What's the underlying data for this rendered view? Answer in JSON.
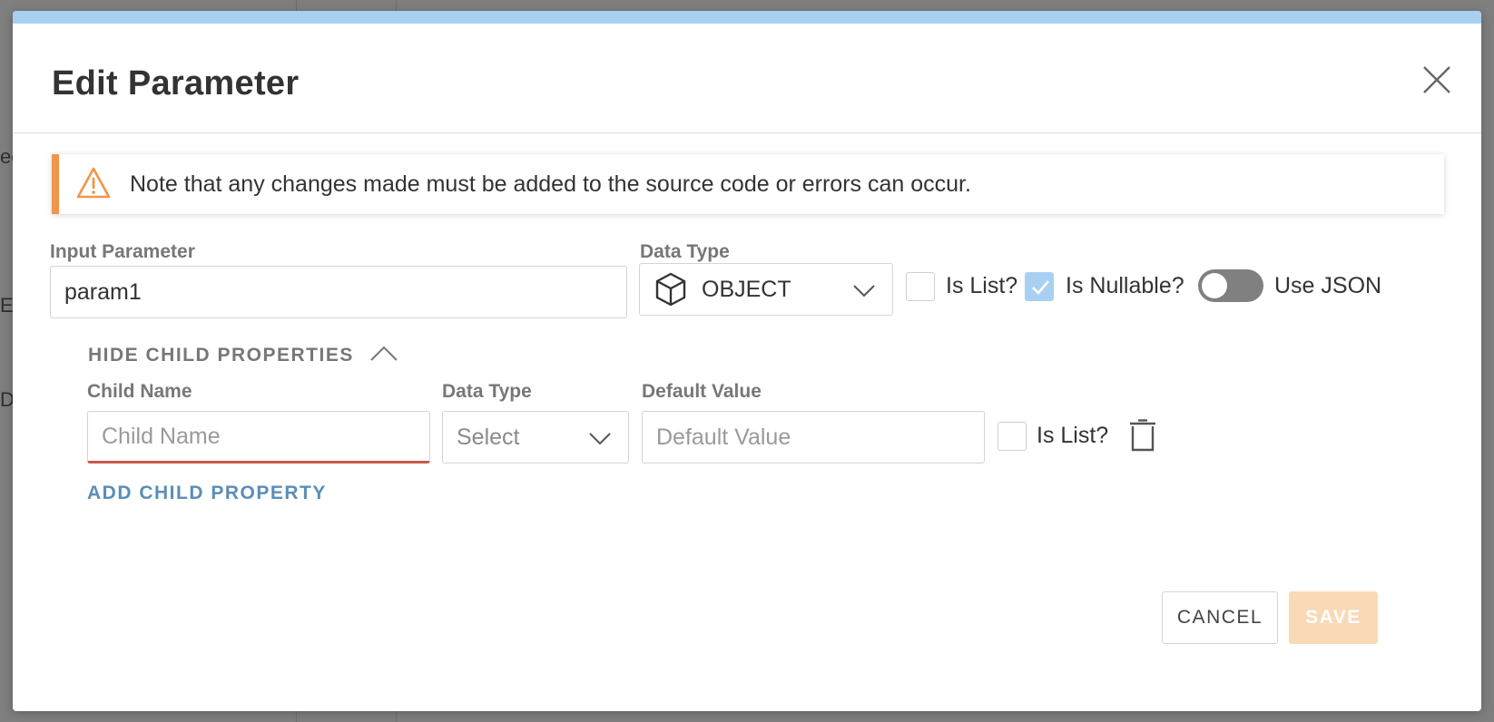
{
  "background": {
    "fragments": [
      "ec",
      "EX",
      "D"
    ]
  },
  "dialog": {
    "title": "Edit Parameter",
    "alert": {
      "icon": "warning-triangle-icon",
      "text": "Note that any changes made must be added to the source code or errors can occur.",
      "accent_color": "#f0954a"
    },
    "input_parameter": {
      "label": "Input Parameter",
      "value": "param1"
    },
    "data_type": {
      "label": "Data Type",
      "icon": "cube-icon",
      "selected": "OBJECT"
    },
    "is_list": {
      "label": "Is List?",
      "checked": false
    },
    "is_nullable": {
      "label": "Is Nullable?",
      "checked": true
    },
    "use_json": {
      "label": "Use JSON",
      "on": false
    },
    "child_properties": {
      "toggle_label": "HIDE CHILD PROPERTIES",
      "columns": {
        "child_name": "Child Name",
        "data_type": "Data Type",
        "default_value": "Default Value"
      },
      "rows": [
        {
          "child_name_placeholder": "Child Name",
          "child_name_value": "",
          "data_type_selected": "Select",
          "default_value_placeholder": "Default Value",
          "default_value_value": "",
          "is_list_label": "Is List?",
          "is_list_checked": false
        }
      ],
      "add_label": "ADD CHILD PROPERTY"
    },
    "buttons": {
      "cancel": "CANCEL",
      "save": "SAVE"
    }
  },
  "colors": {
    "top_bar": "#a9cff0",
    "link": "#5b8db8",
    "checked": "#a8d0f2",
    "error_underline": "#c9574c",
    "save_disabled": "#fad9b6"
  }
}
